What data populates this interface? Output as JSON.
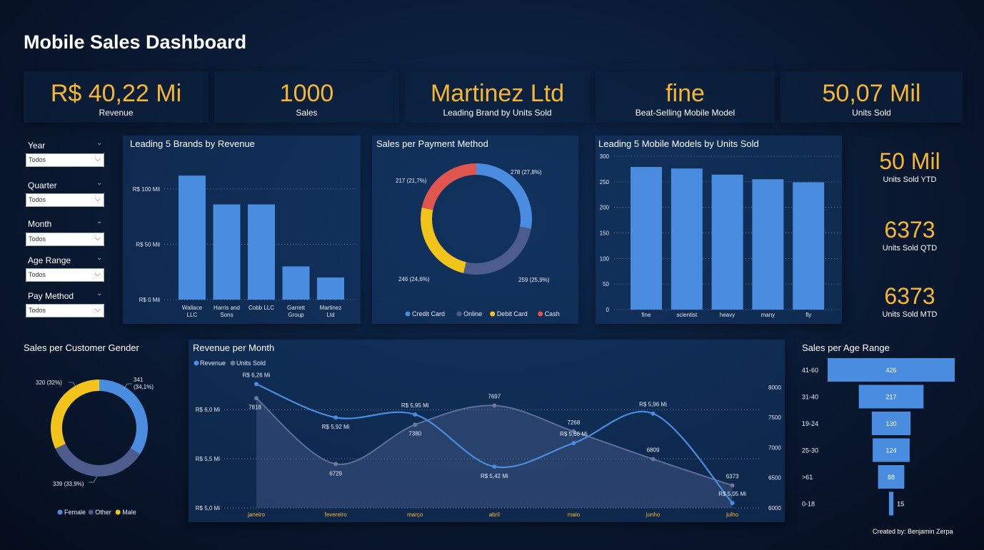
{
  "title": "Mobile Sales Dashboard",
  "kpis": [
    {
      "value": "R$ 40,22 Mi",
      "label": "Revenue"
    },
    {
      "value": "1000",
      "label": "Sales"
    },
    {
      "value": "Martinez Ltd",
      "label": "Leading Brand by Units Sold"
    },
    {
      "value": "fine",
      "label": "Beat-Selling Mobile Model"
    },
    {
      "value": "50,07 Mil",
      "label": "Units Sold"
    }
  ],
  "slicers": [
    {
      "label": "Year",
      "value": "Todos"
    },
    {
      "label": "Quarter",
      "value": "Todos"
    },
    {
      "label": "Month",
      "value": "Todos"
    },
    {
      "label": "Age Range",
      "value": "Todos"
    },
    {
      "label": "Pay Method",
      "value": "Todos"
    }
  ],
  "side_kpis": [
    {
      "value": "50 Mil",
      "label": "Units Sold YTD"
    },
    {
      "value": "6373",
      "label": "Units Sold QTD"
    },
    {
      "value": "6373",
      "label": "Units Sold MTD"
    }
  ],
  "credit": "Created by: Benjamin Zerpa",
  "colors": {
    "accent": "#f5b731",
    "bar": "#4a8ce0",
    "online": "#4d5c8c",
    "debit": "#f2c31a",
    "cash": "#e0564f"
  },
  "chart_data": [
    {
      "id": "brands",
      "type": "bar",
      "title": "Leading 5 Brands by Revenue",
      "categories": [
        "Wallace LLC",
        "Harris and Sons",
        "Cobb LLC",
        "Garrett Group",
        "Martinez Ltd"
      ],
      "values": [
        112,
        86,
        86,
        30,
        20
      ],
      "unit": "R$ Mil",
      "yticks": [
        "R$ 100 Mil",
        "R$ 50 Mil",
        "R$ 0 Mil"
      ],
      "ylim": [
        0,
        125
      ]
    },
    {
      "id": "payment",
      "type": "pie",
      "title": "Sales per Payment Method",
      "slices": [
        {
          "name": "Credit Card",
          "value": 278,
          "label": "278 (27,8%)"
        },
        {
          "name": "Online",
          "value": 259,
          "label": "259 (25,9%)"
        },
        {
          "name": "Debit Card",
          "value": 246,
          "label": "246 (24,6%)"
        },
        {
          "name": "Cash",
          "value": 217,
          "label": "217 (21,7%)"
        }
      ]
    },
    {
      "id": "models",
      "type": "bar",
      "title": "Leading 5 Mobile Models by Units Sold",
      "categories": [
        "fine",
        "scientist",
        "heavy",
        "many",
        "fly"
      ],
      "values": [
        279,
        276,
        264,
        255,
        249
      ],
      "yticks": [
        "300",
        "250",
        "200",
        "150",
        "100",
        "50",
        "0"
      ],
      "ylim": [
        0,
        300
      ]
    },
    {
      "id": "gender",
      "type": "pie",
      "title": "Sales per Customer Gender",
      "slices": [
        {
          "name": "Female",
          "value": 341,
          "label": "341 (34,1%)"
        },
        {
          "name": "Other",
          "value": 339,
          "label": "339 (33,9%)"
        },
        {
          "name": "Male",
          "value": 320,
          "label": "320 (32%)"
        }
      ]
    },
    {
      "id": "monthly",
      "type": "line",
      "title": "Revenue per Month",
      "categories": [
        "janeiro",
        "fevereiro",
        "março",
        "abril",
        "maio",
        "junho",
        "julho"
      ],
      "series": [
        {
          "name": "Revenue",
          "values": [
            6.26,
            5.92,
            5.95,
            5.42,
            5.66,
            5.96,
            5.05
          ],
          "labels": [
            "R$ 6,26 Mi",
            "R$ 5,92 Mi",
            "R$ 5,95 Mi",
            "R$ 5,42 Mi",
            "R$ 5,66 Mi",
            "R$ 5,96 Mi",
            "R$ 5,05 Mi"
          ]
        },
        {
          "name": "Units Sold",
          "values": [
            7818,
            6729,
            7380,
            7697,
            7268,
            6809,
            6373
          ],
          "labels": [
            "7818",
            "6729",
            "7380",
            "7697",
            "7268",
            "6809",
            "6373"
          ]
        }
      ],
      "y_left_ticks": [
        "R$ 6,0 Mi",
        "R$ 5,5 Mi",
        "R$ 5,0 Mi"
      ],
      "y_left_lim": [
        5.0,
        6.35
      ],
      "y_right_ticks": [
        "8000",
        "7500",
        "7000",
        "6500",
        "6000"
      ],
      "y_right_lim": [
        6000,
        8200
      ]
    },
    {
      "id": "age",
      "type": "bar",
      "title": "Sales per Age Range",
      "categories": [
        "41-60",
        "31-40",
        "19-24",
        "25-30",
        ">61",
        "0-18"
      ],
      "values": [
        426,
        217,
        130,
        124,
        88,
        15
      ]
    }
  ]
}
